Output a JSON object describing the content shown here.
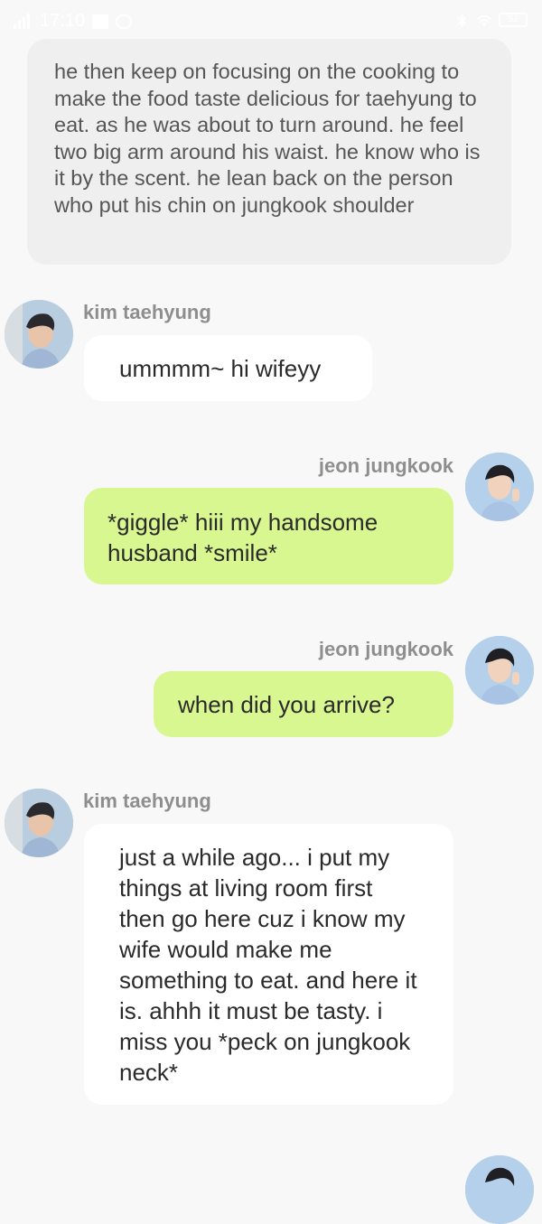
{
  "status_bar": {
    "time": "17:10",
    "battery": "52"
  },
  "narration": {
    "text": "he then keep on focusing on the cooking to make the food taste delicious for taehyung to eat. as he was about to turn around. he feel two big arm around his waist. he know who is it by the scent. he lean back on the person who put his chin on jungkook shoulder"
  },
  "messages": [
    {
      "sender": "kim taehyung",
      "side": "left",
      "text": "ummmm~ hi wifeyy"
    },
    {
      "sender": "jeon jungkook",
      "side": "right",
      "text": "*giggle* hiii my handsome husband *smile*"
    },
    {
      "sender": "jeon jungkook",
      "side": "right",
      "text": "when did you arrive?"
    },
    {
      "sender": "kim taehyung",
      "side": "left",
      "text": "just a while ago... i put my things at living room first then go here cuz i know my wife would make me something to eat. and here it is. ahhh it must be tasty. i miss you *peck on jungkook neck*"
    },
    {
      "sender": "jeon jungkook",
      "side": "right",
      "text": ""
    }
  ],
  "colors": {
    "right_bubble": "#d8f791",
    "left_bubble": "#ffffff",
    "narration_bg": "#efefef",
    "background": "#f8f8f8"
  }
}
